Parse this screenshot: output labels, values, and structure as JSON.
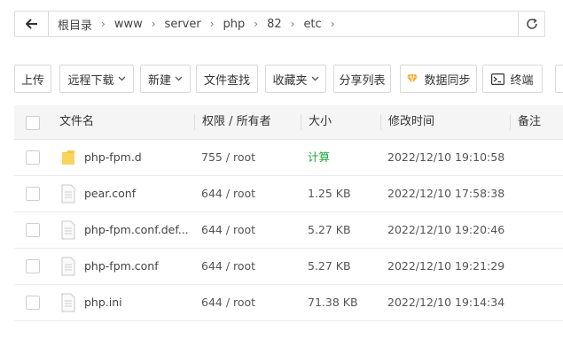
{
  "breadcrumb": {
    "items": [
      "根目录",
      "www",
      "server",
      "php",
      "82",
      "etc"
    ],
    "separator": "›"
  },
  "toolbar": {
    "upload": "上传",
    "remote_download": "远程下载",
    "new": "新建",
    "file_search": "文件查找",
    "favorites": "收藏夹",
    "share_list": "分享列表",
    "data_sync": "数据同步",
    "terminal": "终端"
  },
  "table": {
    "headers": {
      "name": "文件名",
      "perm": "权限 / 所有者",
      "size": "大小",
      "mtime": "修改时间",
      "note": "备注"
    },
    "rows": [
      {
        "type": "folder",
        "name": "php-fpm.d",
        "perm": "755 / root",
        "size": "计算",
        "mtime": "2022/12/10 19:10:58"
      },
      {
        "type": "file",
        "name": "pear.conf",
        "perm": "644 / root",
        "size": "1.25 KB",
        "mtime": "2022/12/10 17:58:38"
      },
      {
        "type": "file",
        "name": "php-fpm.conf.def...",
        "perm": "644 / root",
        "size": "5.27 KB",
        "mtime": "2022/12/10 19:20:46"
      },
      {
        "type": "file",
        "name": "php-fpm.conf",
        "perm": "644 / root",
        "size": "5.27 KB",
        "mtime": "2022/12/10 19:21:29"
      },
      {
        "type": "file",
        "name": "php.ini",
        "perm": "644 / root",
        "size": "71.38 KB",
        "mtime": "2022/12/10 19:14:34"
      }
    ]
  },
  "colors": {
    "accent_green": "#20a53a",
    "folder_yellow": "#f7c948",
    "gem_orange": "#f5a623"
  }
}
